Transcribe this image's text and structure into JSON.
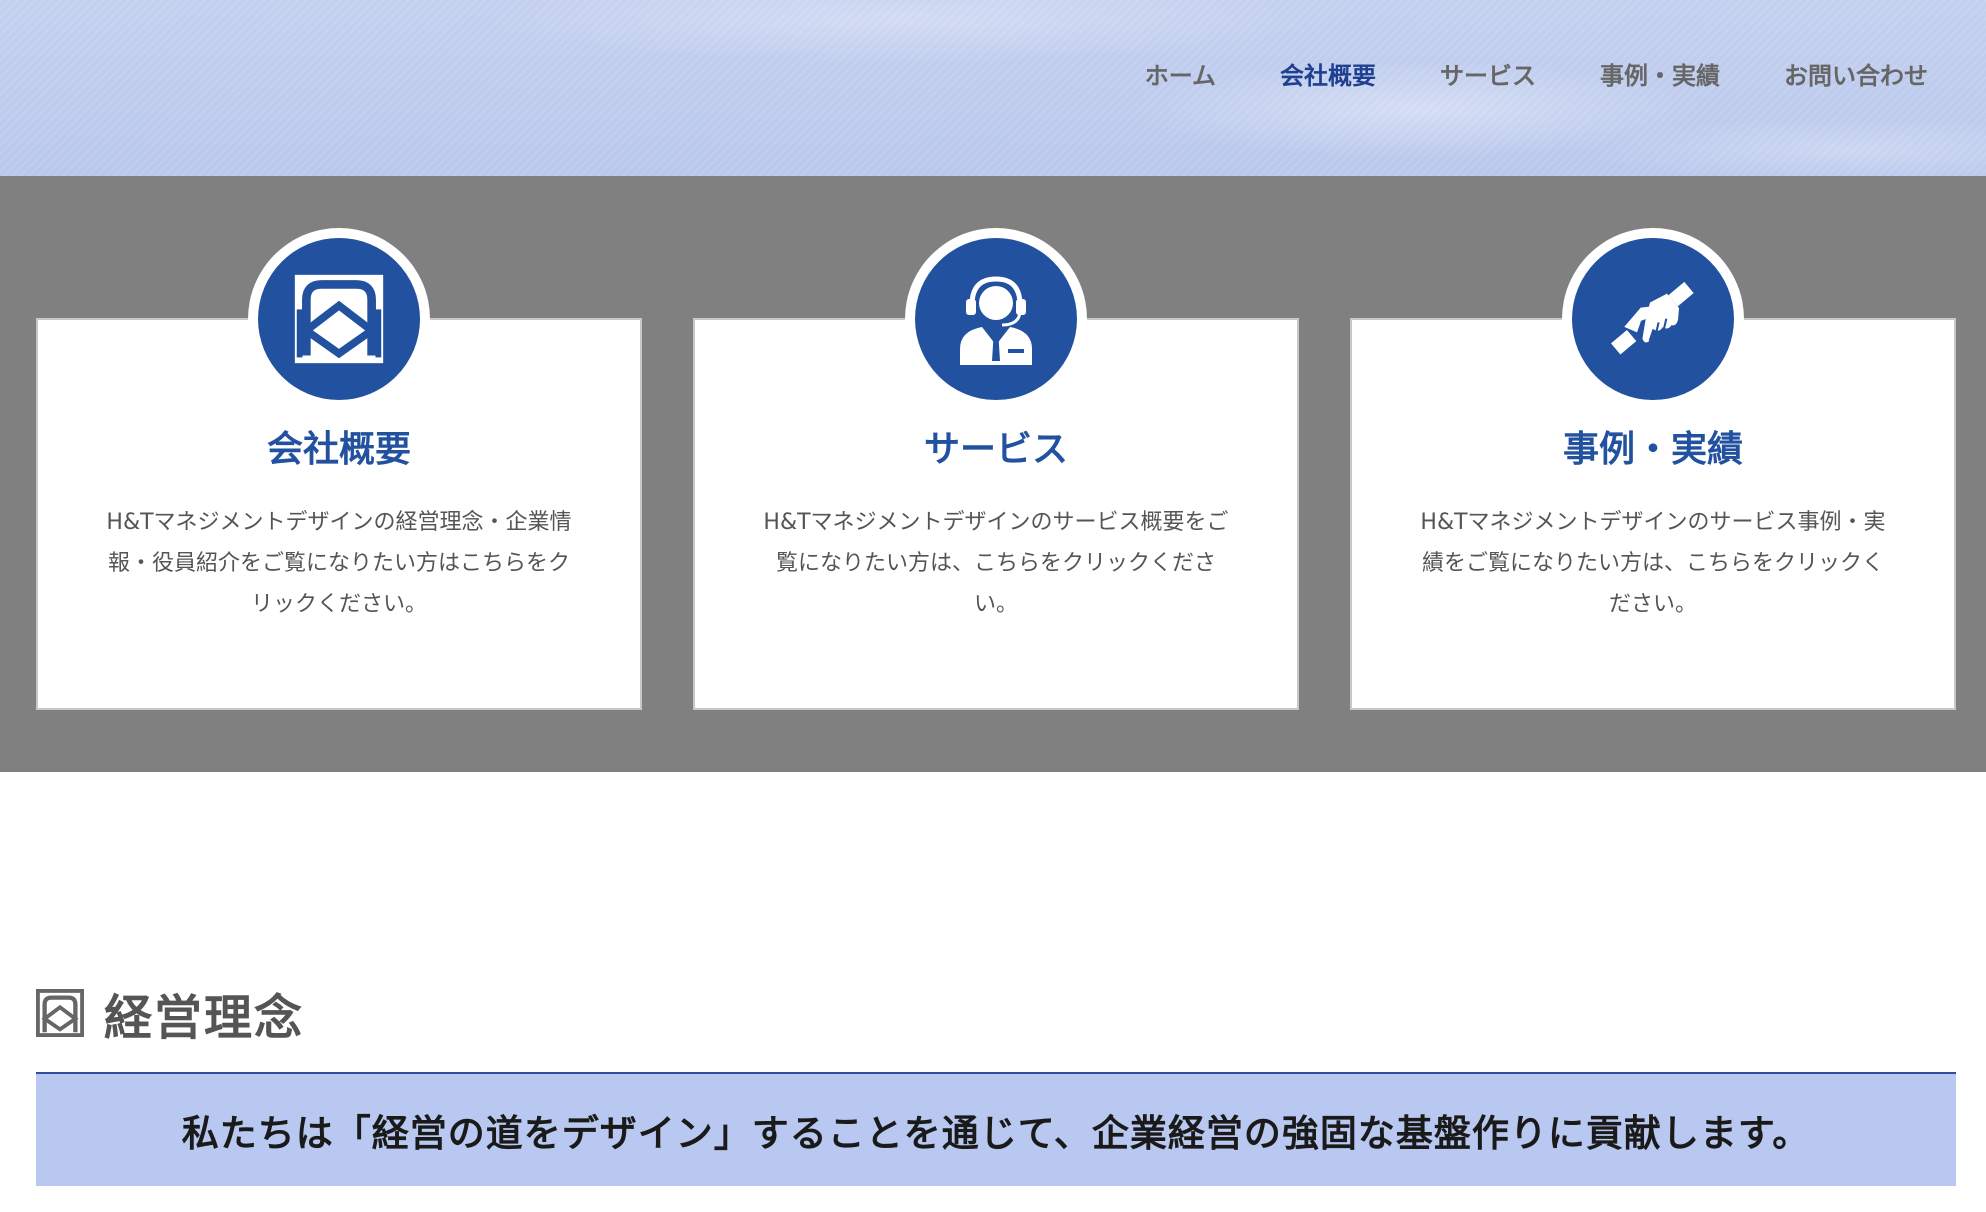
{
  "nav": {
    "items": [
      {
        "label": "ホーム"
      },
      {
        "label": "会社概要",
        "active": true
      },
      {
        "label": "サービス"
      },
      {
        "label": "事例・実績"
      },
      {
        "label": "お問い合わせ"
      }
    ]
  },
  "cards": [
    {
      "title": "会社概要",
      "icon": "company-logo-icon",
      "description": "H&Tマネジメントデザインの経営理念・企業情報・役員紹介をご覧になりたい方はこちらをクリックください。"
    },
    {
      "title": "サービス",
      "icon": "headset-operator-icon",
      "description": "H&Tマネジメントデザインのサービス概要をご覧になりたい方は、こちらをクリックください。"
    },
    {
      "title": "事例・実績",
      "icon": "handshake-icon",
      "description": "H&Tマネジメントデザインのサービス事例・実績をご覧になりたい方は、こちらをクリックください。"
    }
  ],
  "section": {
    "title": "経営理念",
    "icon": "company-logo-icon",
    "banner_text": "私たちは「経営の道をデザイン」することを通じて、企業経営の強固な基盤作りに貢献します。"
  },
  "colors": {
    "brand_blue": "#2251a0",
    "nav_active": "#1f3f8f",
    "band_gray": "#808080",
    "banner_bg": "#b8c8f0"
  }
}
